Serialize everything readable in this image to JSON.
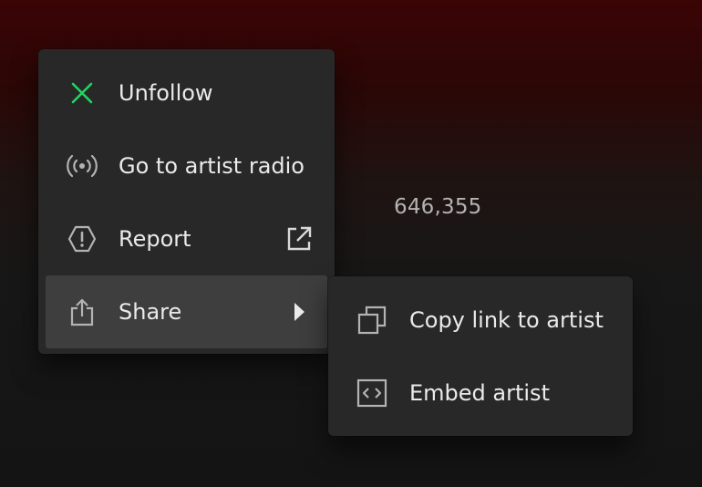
{
  "stats": {
    "count": "646,355"
  },
  "context_menu": {
    "items": [
      {
        "label": "Unfollow",
        "icon": "x-icon",
        "icon_color": "#1ed760"
      },
      {
        "label": "Go to artist radio",
        "icon": "radio-icon"
      },
      {
        "label": "Report",
        "icon": "report-icon",
        "trailing_icon": "external-link-icon"
      },
      {
        "label": "Share",
        "icon": "share-icon",
        "trailing_icon": "chevron-right-icon",
        "active": true
      }
    ]
  },
  "share_submenu": {
    "items": [
      {
        "label": "Copy link to artist",
        "icon": "copy-icon"
      },
      {
        "label": "Embed artist",
        "icon": "embed-icon"
      }
    ]
  },
  "colors": {
    "menu_bg": "#282828",
    "active_bg": "#3e3e3e",
    "accent": "#1ed760",
    "icon": "#b3b3b3",
    "text": "#eaeaea"
  }
}
